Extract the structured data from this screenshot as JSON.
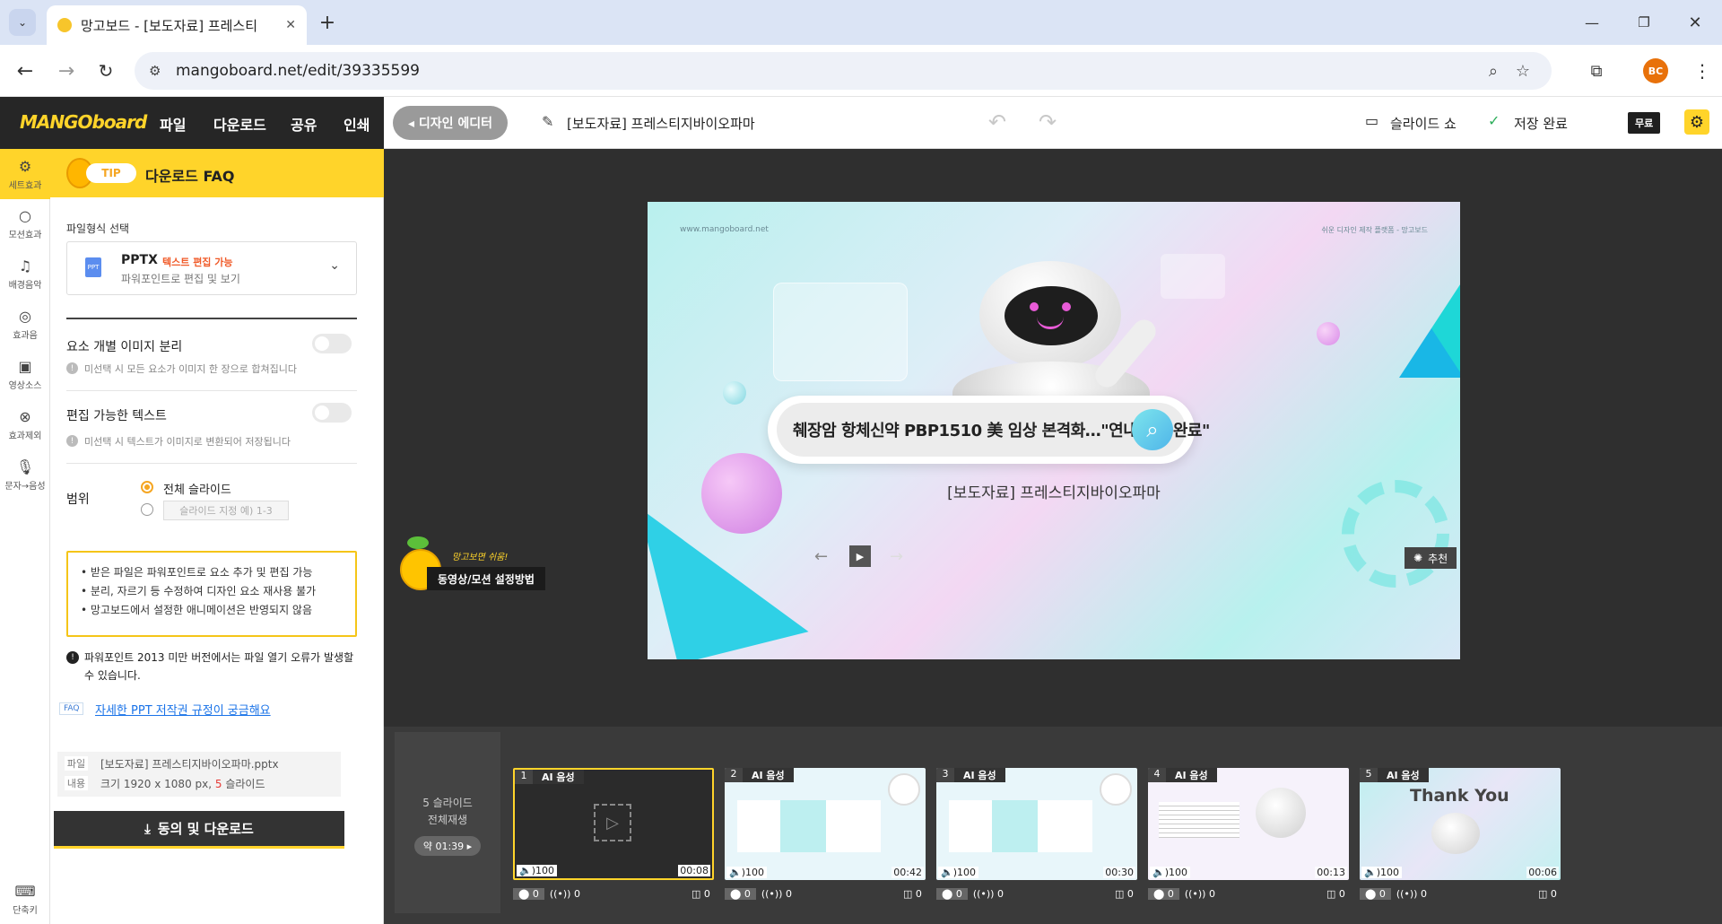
{
  "browser": {
    "tab_title": "망고보드 - [보도자료] 프레스티",
    "url": "mangoboard.net/edit/39335599",
    "profile": "BC"
  },
  "appbar": {
    "logo": "MANGOboard",
    "menus": [
      "파일",
      "다운로드",
      "공유",
      "인쇄"
    ],
    "design_editor": "◂ 디자인 에디터",
    "doc_title": "[보도자료] 프레스티지바이오파마",
    "slideshow": "슬라이드 쇼",
    "saved": "저장 완료",
    "plan": "무료"
  },
  "rail": [
    "세트효과",
    "모션효과",
    "배경음악",
    "효과음",
    "영상소스",
    "효과제외",
    "문자→음성",
    "단축키"
  ],
  "panel": {
    "tip_badge": "TIP",
    "tip_title": "다운로드 FAQ",
    "format_label": "파일형식 선택",
    "format_name": "PPTX",
    "format_badge": "텍스트 편집 가능",
    "format_desc": "파워포인트로 편집 및 보기",
    "opt1_label": "요소 개별 이미지 분리",
    "opt1_note": "미선택 시 모든 요소가 이미지 한 장으로 합쳐집니다",
    "opt2_label": "편집 가능한 텍스트",
    "opt2_note": "미선택 시 텍스트가 이미지로 변환되어 저장됩니다",
    "range_label": "범위",
    "range_all": "전체 슬라이드",
    "range_placeholder": "슬라이드 지정 예) 1-3",
    "notes": [
      "받은 파일은 파워포인트로 요소 추가 및 편집 가능",
      "분리, 자르기 등 수정하여 디자인 요소 재사용 불가",
      "망고보드에서 설정한 애니메이션은 반영되지 않음"
    ],
    "warning": "파워포인트 2013 미만 버전에서는 파일 열기 오류가 발생할 수 있습니다.",
    "faq_tag": "FAQ",
    "faq_link": "자세한 PPT 저작권 규정이 궁금해요",
    "file_label": "파일",
    "file_value": "[보도자료] 프레스티지바이오파마.pptx",
    "content_label": "내용",
    "content_prefix": "크기 1920 x 1080 px, ",
    "content_count": "5",
    "content_suffix": " 슬라이드",
    "download_btn": "동의 및 다운로드"
  },
  "slide": {
    "watermark_url": "www.mangoboard.net",
    "watermark_right": "쉬운 디자인 제작 플랫폼 - 망고보드",
    "headline": "췌장암 항체신약 PBP1510 美 임상 본격화…\"연내 1상 완료\"",
    "subtitle": "[보도자료] 프레스티지바이오파마",
    "recommend": "추천"
  },
  "mascot": {
    "bubble": "망고보면 쉬움!",
    "link": "동영상/모션 설정방법"
  },
  "strip": {
    "play_all_l1": "5 슬라이드",
    "play_all_l2": "전체재생",
    "duration": "약 01:39 ▸",
    "thumbs": [
      {
        "n": "1",
        "tag": "AI 음성",
        "vol": "🔈)100",
        "dur": "00:08",
        "bg": "#2b2b2b"
      },
      {
        "n": "2",
        "tag": "AI 음성",
        "vol": "🔈)100",
        "dur": "00:42",
        "bg": "#e8f6fa"
      },
      {
        "n": "3",
        "tag": "AI 음성",
        "vol": "🔈)100",
        "dur": "00:30",
        "bg": "#e8f6fa"
      },
      {
        "n": "4",
        "tag": "AI 음성",
        "vol": "🔈)100",
        "dur": "00:13",
        "bg": "#f6f2fb"
      },
      {
        "n": "5",
        "tag": "AI 음성",
        "vol": "🔈)100",
        "dur": "00:06",
        "bg": "#d6f1f5",
        "text": "Thank You"
      }
    ],
    "ctrl_values": [
      "0",
      "0",
      "0"
    ]
  }
}
